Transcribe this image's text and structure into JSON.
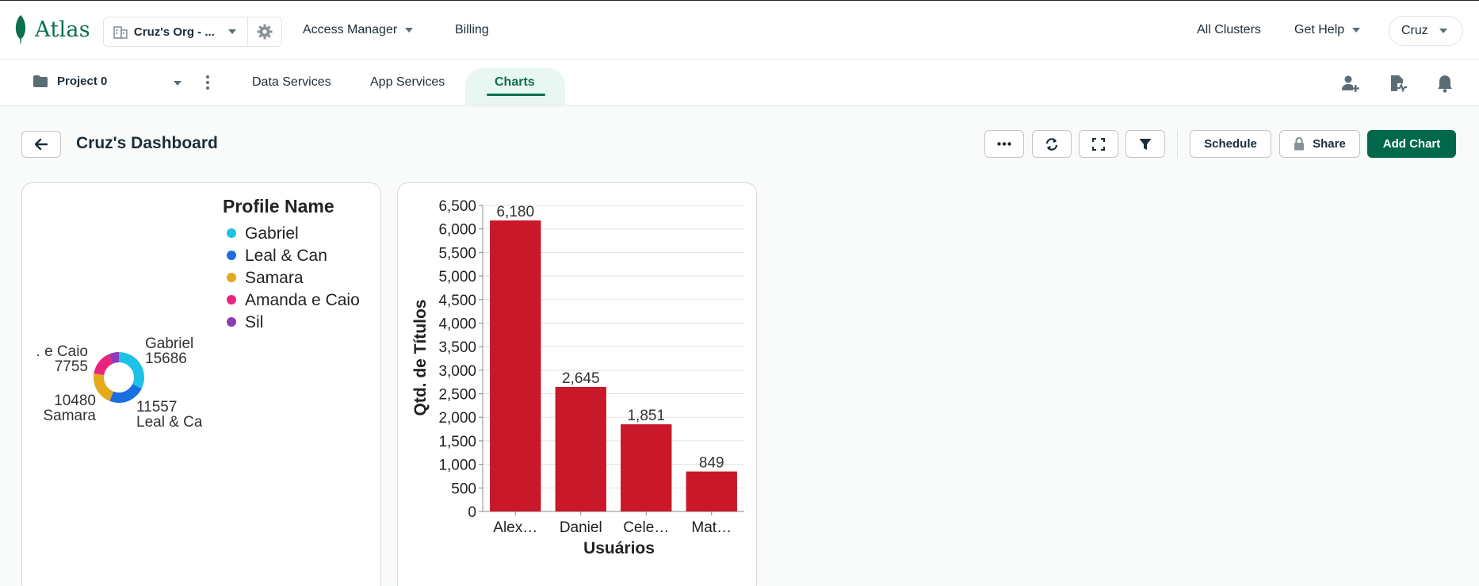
{
  "brand": {
    "name": "Atlas"
  },
  "topnav": {
    "org_name": "Cruz's Org - ...",
    "links": [
      "Access Manager",
      "Billing"
    ],
    "right_links": [
      "All Clusters",
      "Get Help"
    ],
    "user": "Cruz"
  },
  "subnav": {
    "project": "Project 0",
    "tabs": [
      "Data Services",
      "App Services",
      "Charts"
    ],
    "active_tab": "Charts"
  },
  "dashboard": {
    "title": "Cruz's Dashboard",
    "buttons": {
      "schedule": "Schedule",
      "share": "Share",
      "add_chart": "Add Chart"
    }
  },
  "charts": {
    "donut": {
      "legend_title": "Profile Name",
      "legend": [
        {
          "name": "Gabriel",
          "color": "#1ec2e6"
        },
        {
          "name": "Leal & Can",
          "color": "#1a6fe0"
        },
        {
          "name": "Samara",
          "color": "#e5a91e"
        },
        {
          "name": "Amanda e Caio",
          "color": "#e8247f"
        },
        {
          "name": "Sil",
          "color": "#8e3bb5"
        }
      ],
      "labels": [
        {
          "value": "15686",
          "name": "Gabriel"
        },
        {
          "value": "11557",
          "name": "Leal & Ca"
        },
        {
          "value": "10480",
          "name": "Samara"
        },
        {
          "value": "7755",
          "name": ". e Caio"
        }
      ]
    },
    "bar": {
      "xlabel": "Usuários",
      "ylabel": "Qtd. de Títulos",
      "bar_color": "#c8182a",
      "tick_labels": [
        "0",
        "500",
        "1,000",
        "1,500",
        "2,000",
        "2,500",
        "3,000",
        "3,500",
        "4,000",
        "4,500",
        "5,000",
        "5,500",
        "6,000",
        "6,500"
      ],
      "categories_display": [
        "Alex…",
        "Daniel",
        "Cele…",
        "Mat…"
      ],
      "value_labels": [
        "6,180",
        "2,645",
        "1,851",
        "849"
      ]
    }
  },
  "chart_data": [
    {
      "type": "pie",
      "title": "",
      "legend_title": "Profile Name",
      "categories": [
        "Gabriel",
        "Leal & Can",
        "Samara",
        "Amanda e Caio",
        "Sil"
      ],
      "values": [
        15686,
        11557,
        10480,
        7755,
        3200
      ],
      "legend_placement": "top-right"
    },
    {
      "type": "bar",
      "categories": [
        "Alex…",
        "Daniel",
        "Cele…",
        "Mat…"
      ],
      "values": [
        6180,
        2645,
        1851,
        849
      ],
      "title": "",
      "xlabel": "Usuários",
      "ylabel": "Qtd. de Títulos",
      "ylim": [
        0,
        6500
      ],
      "grid": true
    }
  ]
}
